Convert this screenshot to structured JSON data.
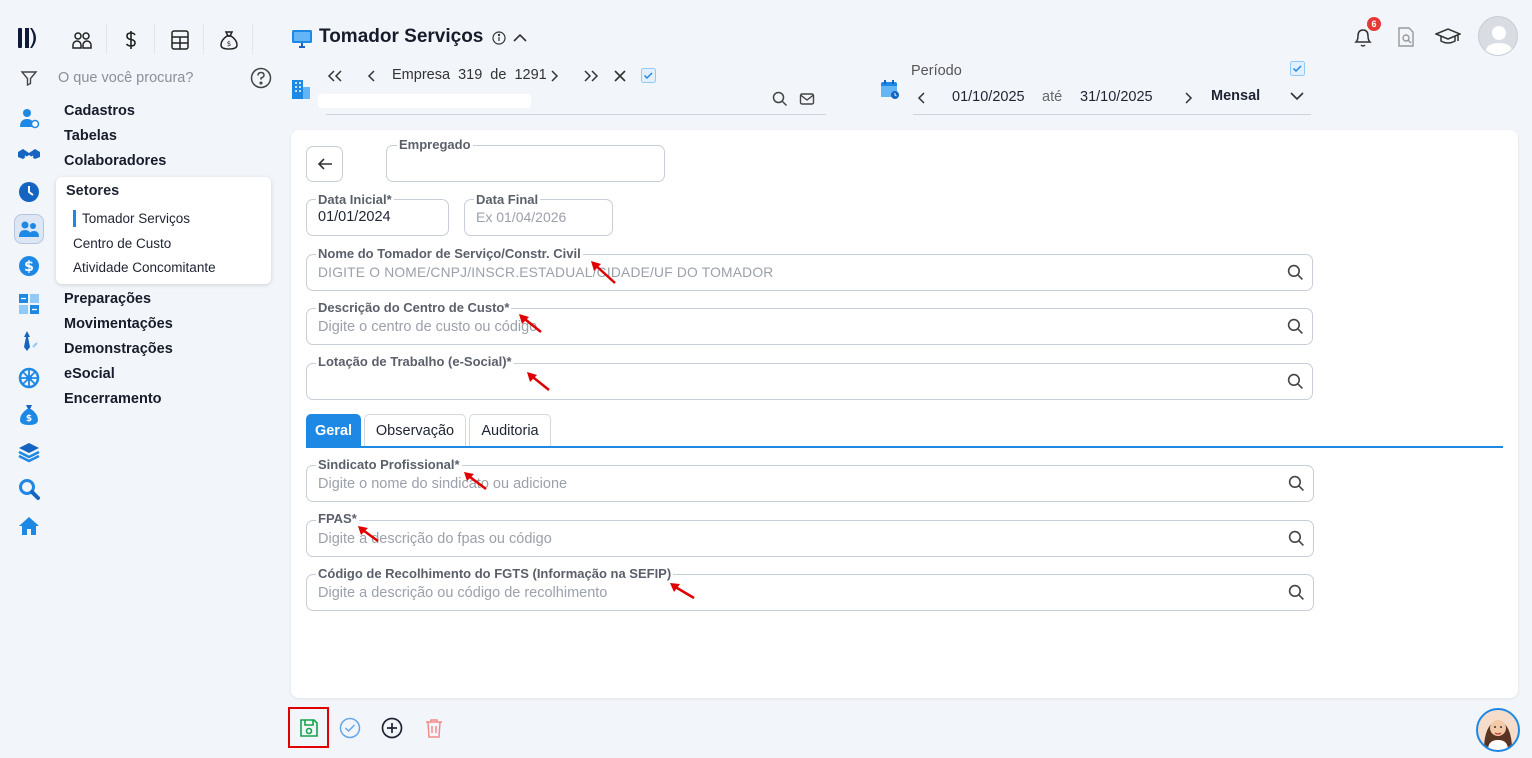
{
  "search": {
    "placeholder": "O que você procura?"
  },
  "menu": {
    "cadastros": "Cadastros",
    "tabelas": "Tabelas",
    "colaboradores": "Colaboradores",
    "setores": {
      "header": "Setores",
      "items": [
        "Tomador Serviços",
        "Centro de Custo",
        "Atividade Concomitante"
      ]
    },
    "preparacoes": "Preparações",
    "movimentacoes": "Movimentações",
    "demonstracoes": "Demonstrações",
    "esocial": "eSocial",
    "encerramento": "Encerramento"
  },
  "header": {
    "title": "Tomador Serviços",
    "empresa_label": "Empresa",
    "empresa_index": "319",
    "empresa_sep": "de",
    "empresa_total": "1291",
    "periodo_label": "Período",
    "date_from": "01/10/2025",
    "date_sep": "até",
    "date_to": "31/10/2025",
    "frequency": "Mensal",
    "notification_count": "6"
  },
  "form": {
    "empregado_label": "Empregado",
    "empregado_value": "",
    "data_inicial_label": "Data Inicial*",
    "data_inicial_value": "01/01/2024",
    "data_final_label": "Data Final",
    "data_final_placeholder": "Ex 01/04/2026",
    "tomador_label": "Nome do Tomador de Serviço/Constr. Civil",
    "tomador_placeholder": "DIGITE O NOME/CNPJ/INSCR.ESTADUAL/CIDADE/UF DO TOMADOR",
    "centro_label": "Descrição do Centro de Custo*",
    "centro_placeholder": "Digite o centro de custo ou código",
    "lotacao_label": "Lotação de Trabalho (e-Social)*",
    "lotacao_value": "",
    "tabs": [
      "Geral",
      "Observação",
      "Auditoria"
    ],
    "sindicato_label": "Sindicato Profissional*",
    "sindicato_placeholder": "Digite o nome do sindicato ou adicione",
    "fpas_label": "FPAS*",
    "fpas_placeholder": "Digite a descrição do fpas ou código",
    "fgts_label": "Código de Recolhimento do FGTS (Informação na SEFIP)",
    "fgts_placeholder": "Digite a descrição ou código de recolhimento"
  },
  "colors": {
    "accent": "#1e88e5",
    "arrow": "#e00000",
    "save": "#16a34a",
    "delete": "#f28b8b"
  }
}
